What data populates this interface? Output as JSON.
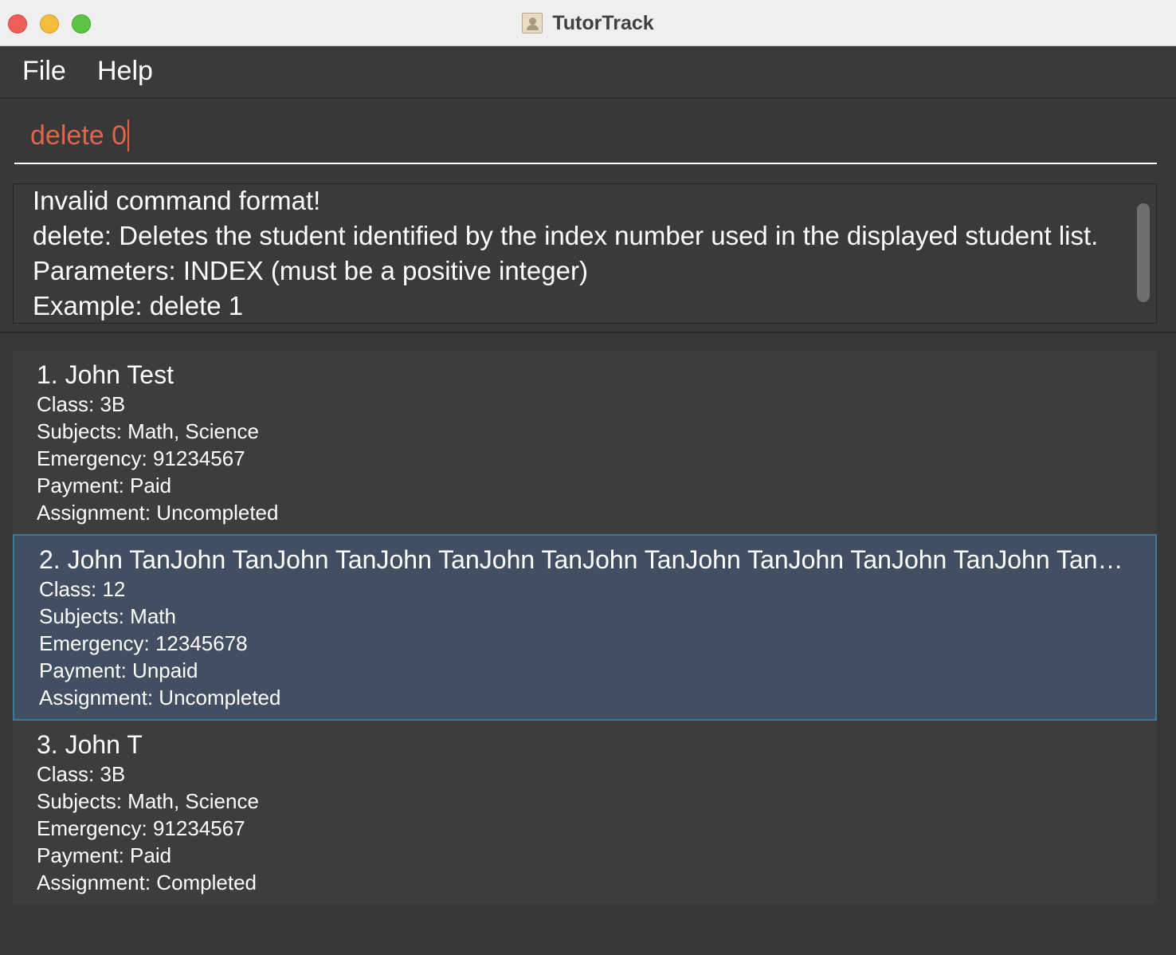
{
  "window": {
    "title": "TutorTrack"
  },
  "menu": {
    "file": "File",
    "help": "Help"
  },
  "command": {
    "value": "delete 0"
  },
  "result": {
    "lines": [
      "Invalid command format!",
      "delete: Deletes the student identified by the index number used in the displayed student list.",
      "Parameters: INDEX (must be a positive integer)",
      "Example: delete 1"
    ]
  },
  "students": [
    {
      "name": "1. John Test",
      "class": "Class: 3B",
      "subjects": "Subjects: Math, Science",
      "emergency": "Emergency: 91234567",
      "payment": "Payment: Paid",
      "assignment": "Assignment: Uncompleted"
    },
    {
      "name": "2. John TanJohn TanJohn TanJohn TanJohn TanJohn TanJohn TanJohn TanJohn TanJohn TanJohn …",
      "class": "Class: 12",
      "subjects": "Subjects: Math",
      "emergency": "Emergency: 12345678",
      "payment": "Payment: Unpaid",
      "assignment": "Assignment: Uncompleted"
    },
    {
      "name": "3. John T",
      "class": "Class: 3B",
      "subjects": "Subjects: Math, Science",
      "emergency": "Emergency: 91234567",
      "payment": "Payment: Paid",
      "assignment": "Assignment: Completed"
    }
  ],
  "colors": {
    "background": "#383838",
    "command_text": "#e0654a",
    "selected_card": "#424f62",
    "selected_border": "#3b7a98"
  }
}
